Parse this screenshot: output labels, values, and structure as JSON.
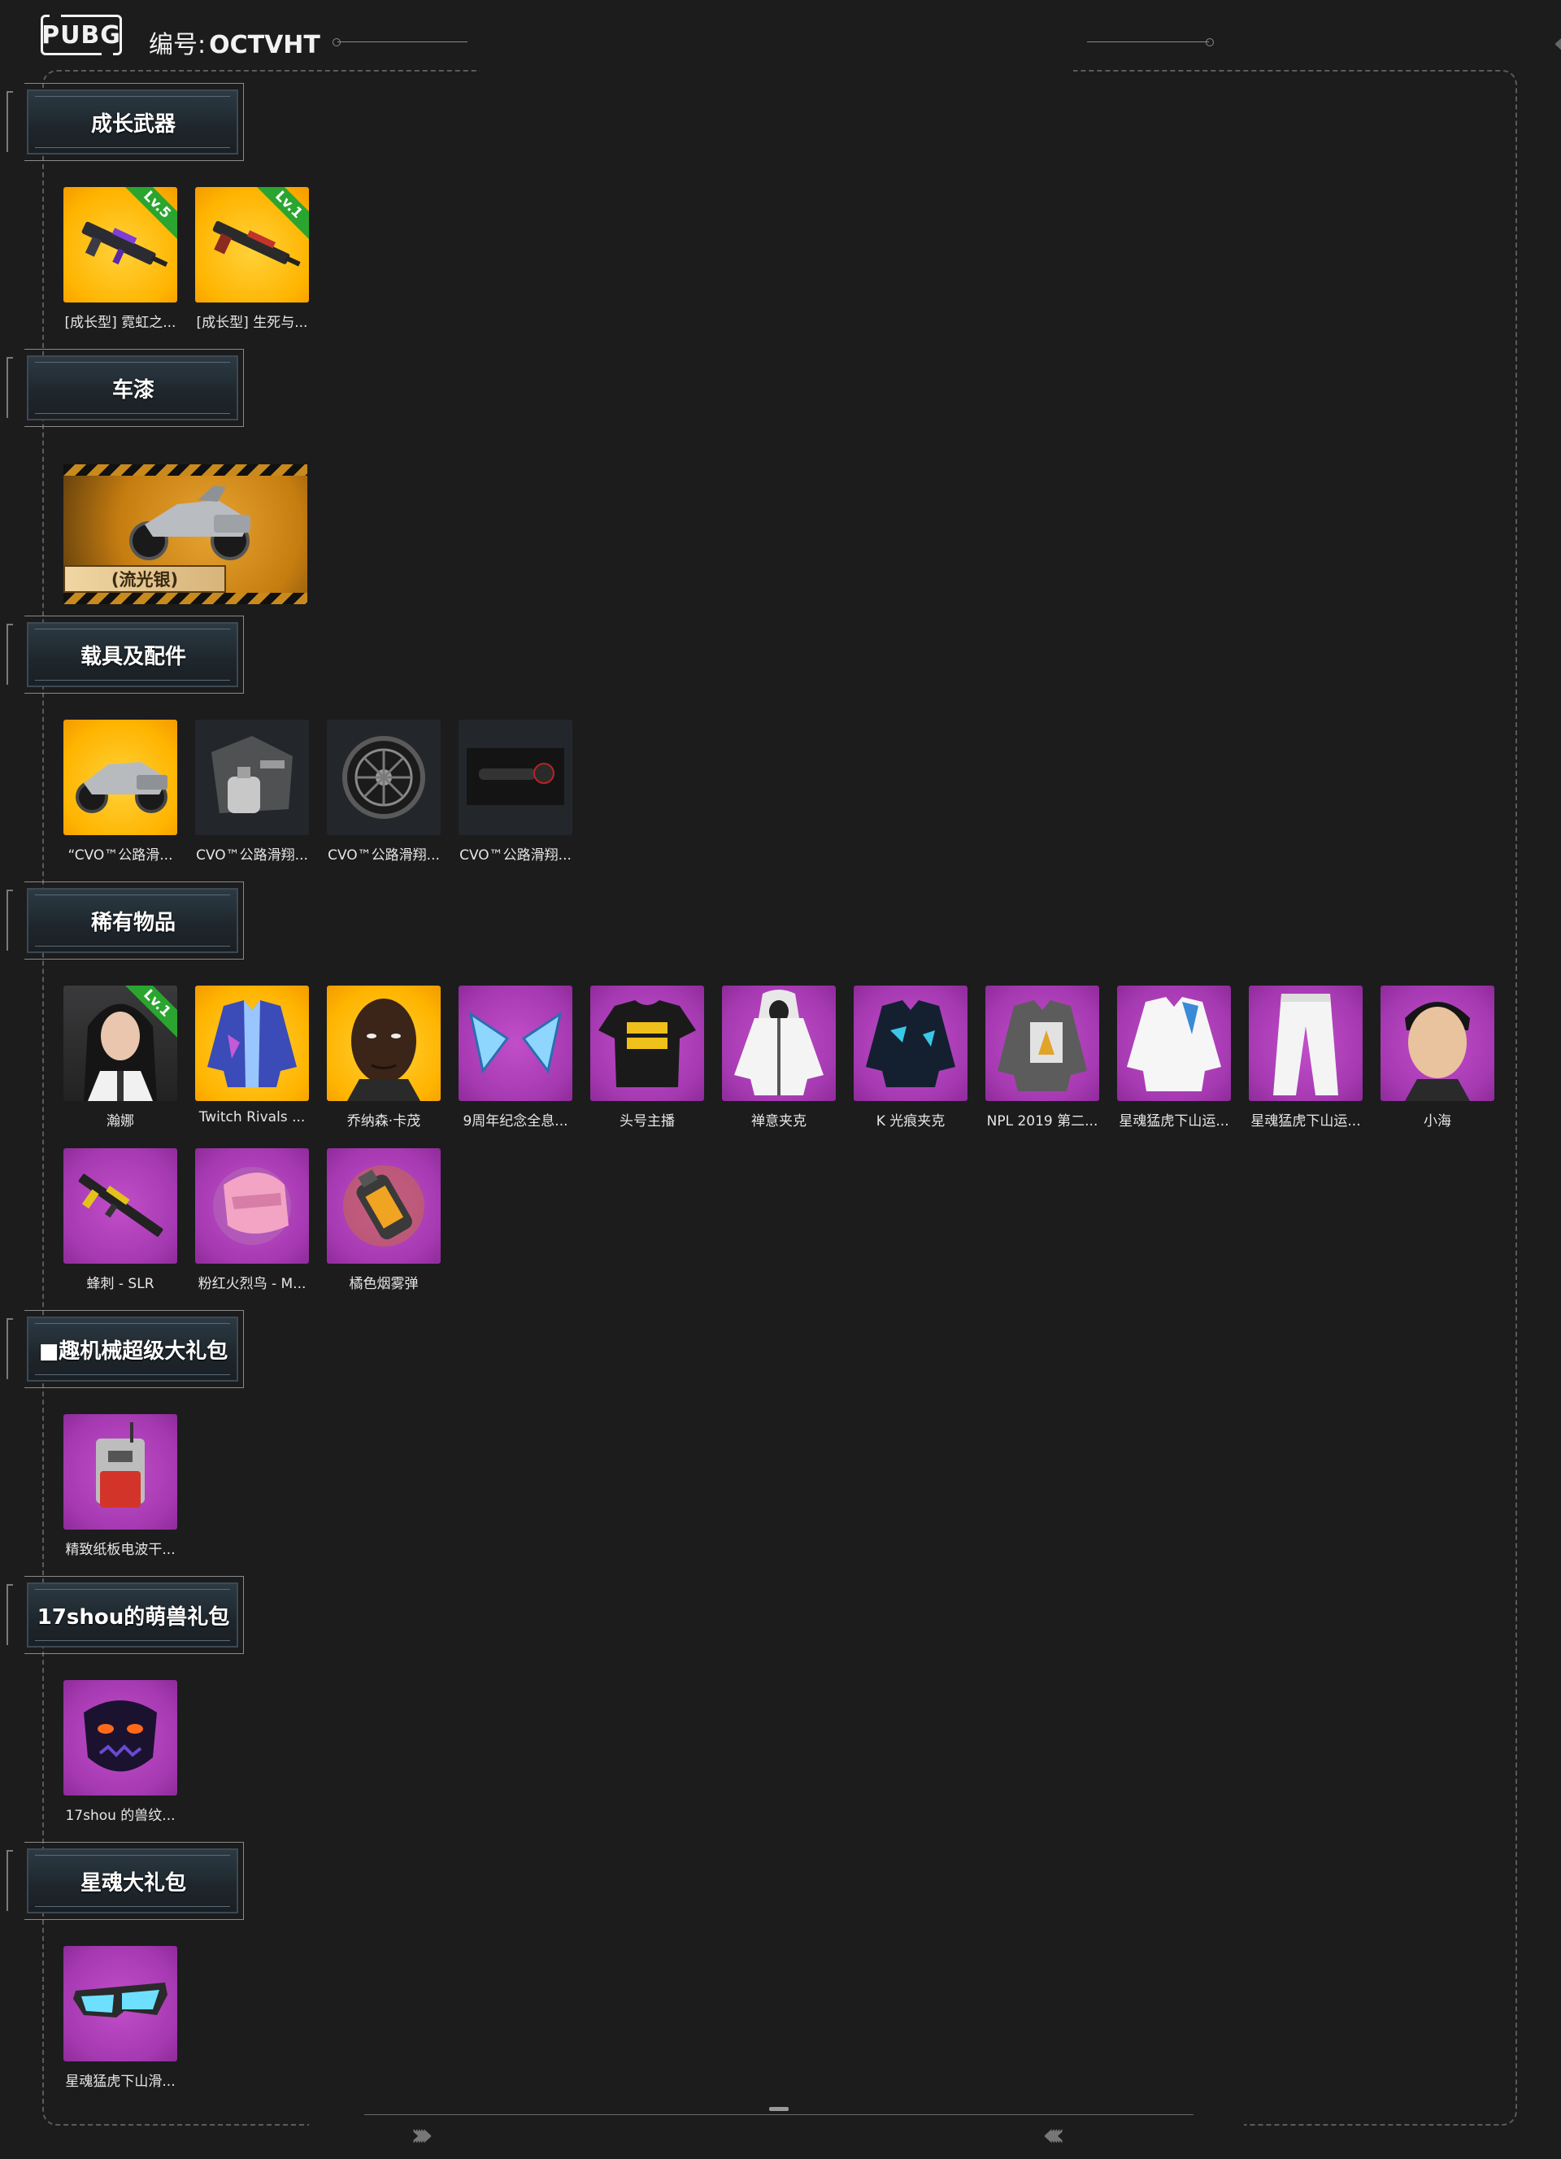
{
  "header": {
    "logo_text": "PUBG",
    "serial_label": "编号:",
    "serial_value": "OCTVHT"
  },
  "sections": [
    {
      "title": "成长武器",
      "items": [
        {
          "caption": "[成长型] 霓虹之...",
          "bg": "gold",
          "level": "Lv.5",
          "icon": "rifle-icon"
        },
        {
          "caption": "[成长型] 生死与...",
          "bg": "gold",
          "level": "Lv.1",
          "icon": "rifle-icon"
        }
      ]
    },
    {
      "title": "车漆",
      "vehicle_card": {
        "tag": "(流光银)",
        "icon": "motorcycle-icon"
      }
    },
    {
      "title": "载具及配件",
      "items": [
        {
          "caption": "“CVO™公路滑...",
          "bg": "gold",
          "icon": "motorcycle-icon"
        },
        {
          "caption": "CVO™公路滑翔...",
          "bg": "dark",
          "icon": "engine-icon"
        },
        {
          "caption": "CVO™公路滑翔...",
          "bg": "dark",
          "icon": "wheel-icon"
        },
        {
          "caption": "CVO™公路滑翔...",
          "bg": "dark",
          "icon": "exhaust-icon"
        }
      ]
    },
    {
      "title": "稀有物品",
      "items": [
        {
          "caption": "瀚娜",
          "bg": "dark2",
          "level": "Lv.1",
          "icon": "character-icon"
        },
        {
          "caption": "Twitch Rivals ...",
          "bg": "gold",
          "icon": "jacket-icon"
        },
        {
          "caption": "乔纳森·卡茂",
          "bg": "gold",
          "icon": "face-icon"
        },
        {
          "caption": "9周年纪念全息...",
          "bg": "purple",
          "icon": "ears-icon"
        },
        {
          "caption": "头号主播",
          "bg": "purple",
          "icon": "tshirt-icon"
        },
        {
          "caption": "禅意夹克",
          "bg": "purple",
          "icon": "hoodie-icon"
        },
        {
          "caption": "K 光痕夹克",
          "bg": "purple",
          "icon": "jacket-icon"
        },
        {
          "caption": "NPL 2019 第二...",
          "bg": "purple",
          "icon": "jacket-icon"
        },
        {
          "caption": "星魂猛虎下山运...",
          "bg": "purple",
          "icon": "shirt-icon"
        },
        {
          "caption": "星魂猛虎下山运...",
          "bg": "purple",
          "icon": "pants-icon"
        },
        {
          "caption": "小海",
          "bg": "purple",
          "icon": "face-icon"
        },
        {
          "caption": "蜂刺 - SLR",
          "bg": "purple",
          "icon": "rifle-icon"
        },
        {
          "caption": "粉红火烈鸟 - M...",
          "bg": "purple",
          "icon": "helmet-icon"
        },
        {
          "caption": "橘色烟雾弹",
          "bg": "purple",
          "icon": "grenade-icon"
        }
      ]
    },
    {
      "title": "■趣机械超级大礼包",
      "items": [
        {
          "caption": "精致纸板电波干...",
          "bg": "purple",
          "icon": "backpack-icon"
        }
      ]
    },
    {
      "title": "17shou的萌兽礼包",
      "items": [
        {
          "caption": "17shou 的兽纹...",
          "bg": "purple",
          "icon": "mask-icon"
        }
      ]
    },
    {
      "title": "星魂大礼包",
      "items": [
        {
          "caption": "星魂猛虎下山滑...",
          "bg": "purple",
          "icon": "goggles-icon"
        }
      ]
    }
  ]
}
